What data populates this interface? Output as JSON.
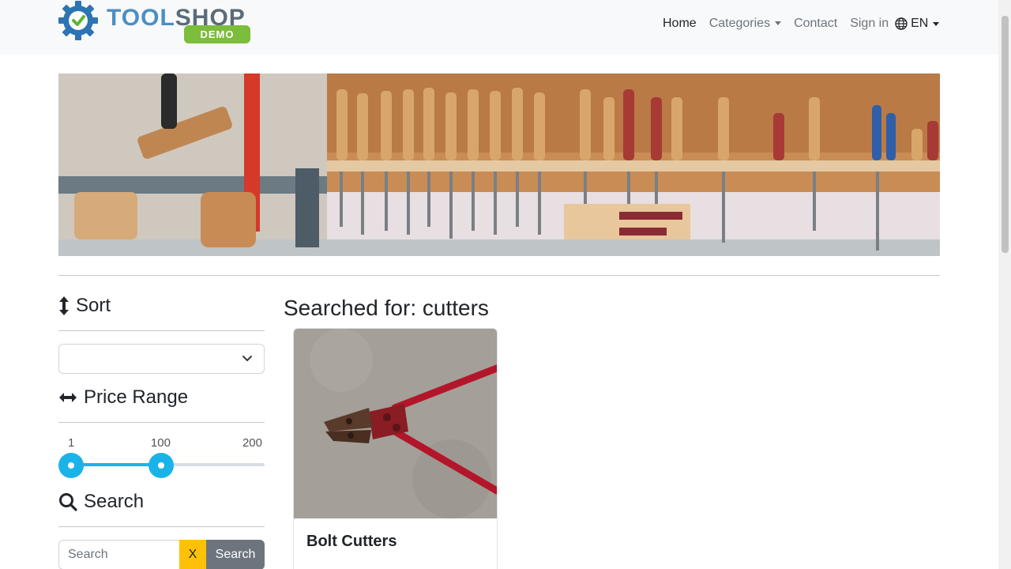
{
  "brand": {
    "name_part1": "TOOL",
    "name_part2": "SHOP",
    "badge": "DEMO"
  },
  "nav": {
    "home": "Home",
    "categories": "Categories",
    "contact": "Contact",
    "sign_in": "Sign in",
    "language": "EN"
  },
  "sidebar": {
    "sort_heading": "Sort",
    "sort_selected": "",
    "price_heading": "Price Range",
    "price_min_label": "1",
    "price_current_label": "100",
    "price_max_label": "200",
    "price_min": 1,
    "price_current": 100,
    "price_max": 200,
    "search_heading": "Search",
    "search_placeholder": "Search",
    "clear_label": "X",
    "search_button": "Search"
  },
  "main": {
    "results_title": "Searched for: cutters",
    "products": [
      {
        "name": "Bolt Cutters"
      }
    ]
  },
  "colors": {
    "accent": "#1ab3e8",
    "clear_button": "#ffc107",
    "search_button": "#6c757d",
    "brand_demo": "#7cbd3c"
  }
}
